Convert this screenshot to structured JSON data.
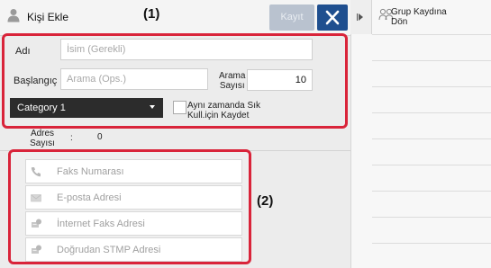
{
  "header": {
    "title": "Kişi Ekle",
    "save_label": "Kayıt",
    "callout": "(1)"
  },
  "form": {
    "name_label": "Adı",
    "name_placeholder": "İsim (Gerekli)",
    "start_label": "Başlangıç",
    "start_placeholder": "Arama (Ops.)",
    "search_count_label_line1": "Arama",
    "search_count_label_line2": "Sayısı",
    "search_count_value": "10",
    "category_value": "Category 1",
    "favorite_label_line1": "Aynı zamanda Sık",
    "favorite_label_line2": "Kull.için Kaydet"
  },
  "address_count": {
    "label_line1": "Adres",
    "label_line2": "Sayısı",
    "colon": ":",
    "value": "0"
  },
  "addresses": {
    "callout": "(2)",
    "items": [
      {
        "label": "Faks Numarası",
        "icon": "phone-icon"
      },
      {
        "label": "E-posta Adresi",
        "icon": "envelope-icon"
      },
      {
        "label": "İnternet Faks Adresi",
        "icon": "internet-fax-icon"
      },
      {
        "label": "Doğrudan STMP Adresi",
        "icon": "direct-smtp-icon"
      }
    ]
  },
  "right_panel": {
    "return_label_line1": "Grup Kaydına",
    "return_label_line2": "Dön"
  },
  "colors": {
    "highlight": "#d9243a",
    "close_button": "#1f4f8f",
    "save_button_disabled": "#b9c2cf",
    "category_select": "#2c2c2c"
  }
}
